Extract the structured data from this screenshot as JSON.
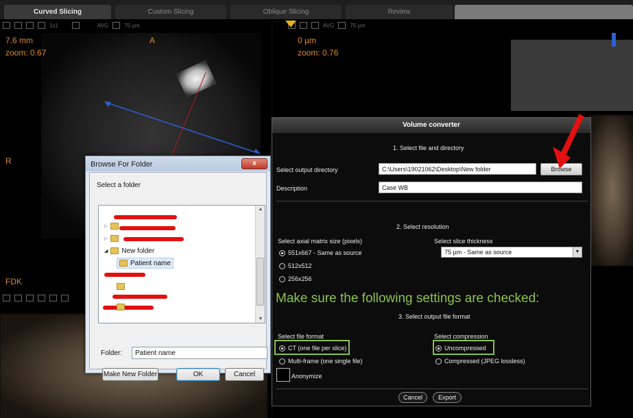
{
  "tabs": [
    {
      "label": "Curved Slicing",
      "active": true
    },
    {
      "label": "Custom Slicing",
      "active": false
    },
    {
      "label": "Oblique Slicing",
      "active": false
    },
    {
      "label": "Review",
      "active": false
    }
  ],
  "viewport_a": {
    "toolbar_layout": "1x1",
    "toolbar_mode": "AVG",
    "toolbar_thickness": "75 µm",
    "label": "A",
    "distance": "7.6 mm",
    "zoom": "zoom: 0.67",
    "side_label": "R",
    "bottom_label": "FDK"
  },
  "viewport_b": {
    "toolbar_mode": "AVG",
    "toolbar_thickness": "75 µm",
    "distance": "0 µm",
    "zoom": "zoom: 0.76"
  },
  "browse_dialog": {
    "title": "Browse For Folder",
    "close": "x",
    "prompt": "Select a folder",
    "tree": [
      {
        "label": "New folder"
      },
      {
        "label": "Patient name"
      }
    ],
    "folder_label": "Folder:",
    "folder_value": "Patient name",
    "make_new_folder": "Make New Folder",
    "ok": "OK",
    "cancel": "Cancel"
  },
  "converter": {
    "title": "Volume converter",
    "step1": "1. Select file and directory",
    "output_dir_label": "Select output directory",
    "output_dir_value": "C:\\Users\\19021062\\Desktop\\New folder",
    "browse": "Browse",
    "description_label": "Description",
    "description_value": "Case WB",
    "step2": "2. Select resolution",
    "matrix_label": "Select axial matrix size (pixels)",
    "matrix_options": [
      "551x667 - Same as source",
      "512x512",
      "256x256"
    ],
    "matrix_selected": 0,
    "thickness_label": "Select slice thickness",
    "thickness_value": "75 µm - Same as source",
    "note": "Make sure the following settings are checked:",
    "step3": "3. Select output file format",
    "format_label": "Select file format",
    "format_options": [
      "CT (one file per slice)",
      "Multi-frame (one single file)"
    ],
    "compression_label": "Select compression",
    "compression_options": [
      "Uncompressed",
      "Compressed (JPEG lossless)"
    ],
    "anonymize": "Anonymize",
    "cancel": "Cancel",
    "export": "Export"
  },
  "colors": {
    "accent_orange": "#e08a2a",
    "highlight_green": "#8bc34a",
    "annotation_red": "#e31010",
    "overlay_blue": "#2f5fd0"
  }
}
